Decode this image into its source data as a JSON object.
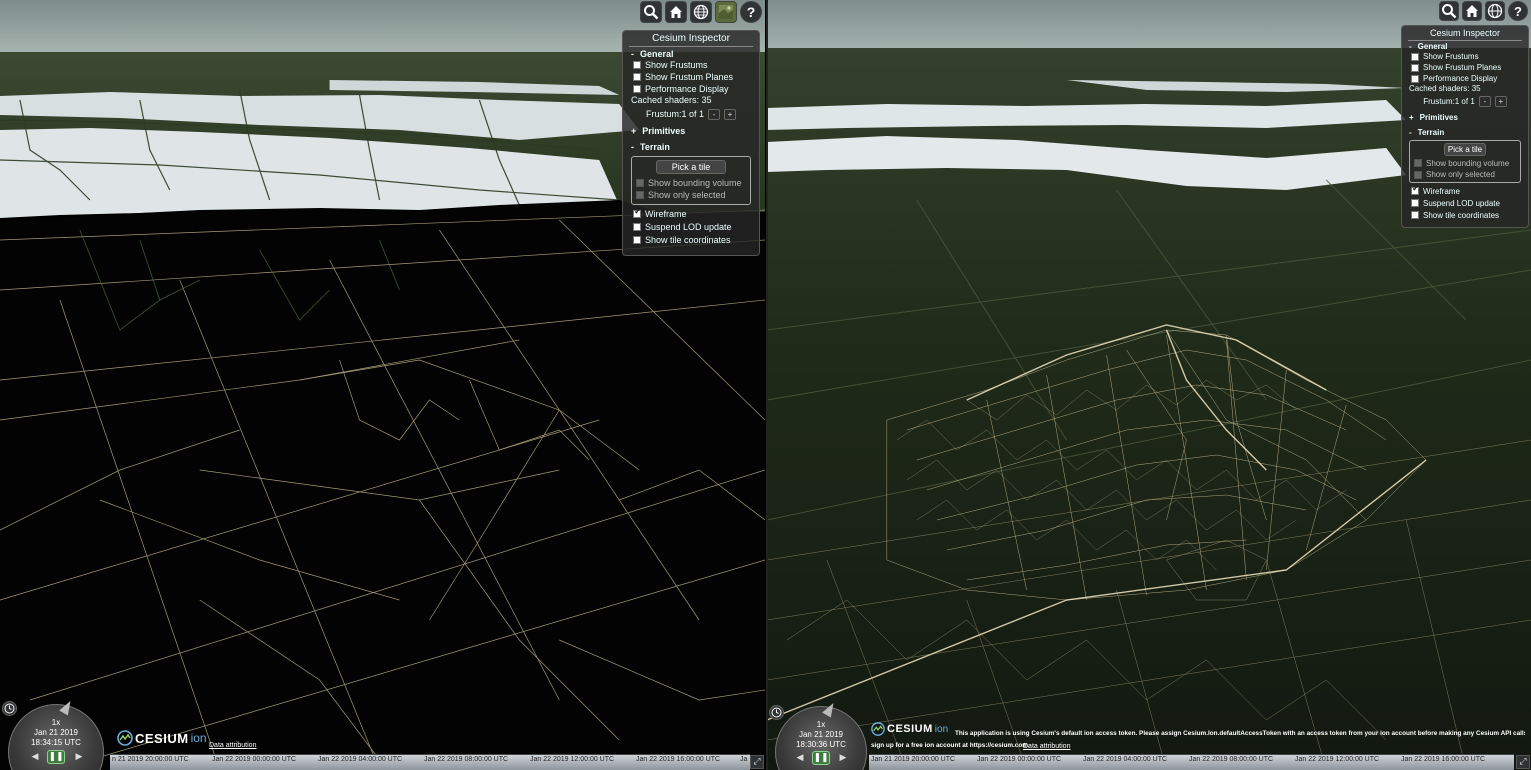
{
  "toolbar": {
    "icons": [
      "search-icon",
      "home-icon",
      "globe-icon",
      "imagery-layers-icon",
      "help-icon"
    ],
    "help_label": "?"
  },
  "left": {
    "inspector": {
      "title": "Cesium Inspector",
      "general": {
        "toggle": "-",
        "label": "General",
        "items": [
          {
            "label": "Show Frustums",
            "checked": false
          },
          {
            "label": "Show Frustum Planes",
            "checked": false
          },
          {
            "label": "Performance Display",
            "checked": false
          }
        ],
        "cached_shaders": "Cached shaders: 35",
        "frustum": "Frustum:1 of 1",
        "minus": "-",
        "plus": "+"
      },
      "primitives": {
        "toggle": "+",
        "label": "Primitives"
      },
      "terrain": {
        "toggle": "-",
        "label": "Terrain",
        "pick_tile": "Pick a tile",
        "show_bounding_volume": "Show bounding volume",
        "show_only_selected": "Show only selected",
        "items": [
          {
            "label": "Wireframe",
            "checked": true
          },
          {
            "label": "Suspend LOD update",
            "checked": false
          },
          {
            "label": "Show tile coordinates",
            "checked": false
          }
        ]
      }
    },
    "animation": {
      "speed": "1x",
      "date": "Jan 21 2019",
      "time": "18:34:15 UTC"
    },
    "timeline": [
      "n 21 2019 20:00:00 UTC",
      "Jan 22 2019 00:00:00 UTC",
      "Jan 22 2019 04:00:00 UTC",
      "Jan 22 2019 08:00:00 UTC",
      "Jan 22 2019 12:00:00 UTC",
      "Jan 22 2019 16:00:00 UTC",
      "Ja"
    ],
    "logo_cesium": "CESIUM",
    "logo_ion": "ion",
    "data_attribution": "Data attribution"
  },
  "right": {
    "inspector": {
      "title": "Cesium Inspector",
      "general": {
        "toggle": "-",
        "label": "General",
        "items": [
          {
            "label": "Show Frustums",
            "checked": false
          },
          {
            "label": "Show Frustum Planes",
            "checked": false
          },
          {
            "label": "Performance Display",
            "checked": false
          }
        ],
        "cached_shaders": "Cached shaders: 35",
        "frustum": "Frustum:1 of 1",
        "minus": "-",
        "plus": "+"
      },
      "primitives": {
        "toggle": "+",
        "label": "Primitives"
      },
      "terrain": {
        "toggle": "-",
        "label": "Terrain",
        "pick_tile": "Pick a tile",
        "show_bounding_volume": "Show bounding volume",
        "show_only_selected": "Show only selected",
        "items": [
          {
            "label": "Wireframe",
            "checked": true
          },
          {
            "label": "Suspend LOD update",
            "checked": false
          },
          {
            "label": "Show tile coordinates",
            "checked": false
          }
        ]
      }
    },
    "animation": {
      "speed": "1x",
      "date": "Jan 21 2019",
      "time": "18:30:36 UTC"
    },
    "timeline": [
      "Jan 21 2019 20:00:00 UTC",
      "Jan 22 2019 00:00:00 UTC",
      "Jan 22 2019 04:00:00 UTC",
      "Jan 22 2019 08:00:00 UTC",
      "Jan 22 2019 12:00:00 UTC",
      "Jan 22 2019 16:00:00 UTC"
    ],
    "logo_cesium": "CESIUM",
    "logo_ion": "ion",
    "notice_line1": "This application is using Cesium's default ion access token. Please assign Cesium.Ion.defaultAccessToken with an access token from your ion account before making any Cesium API calls. You can",
    "notice_line2": "sign up for a free ion account at https://cesium.com.",
    "data_attribution": "Data attribution"
  }
}
